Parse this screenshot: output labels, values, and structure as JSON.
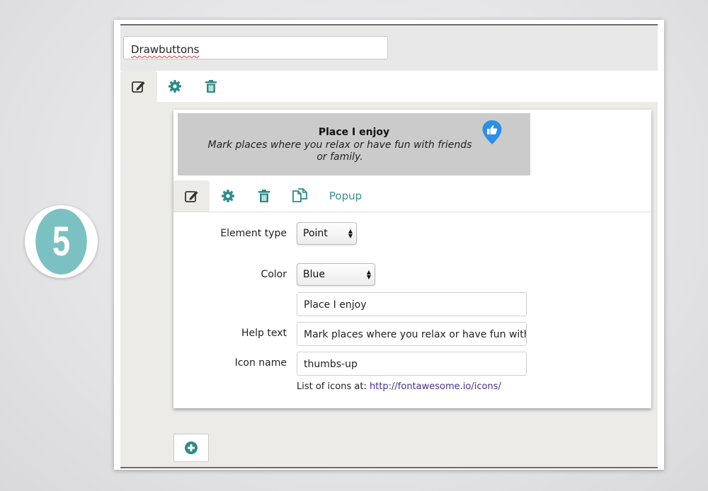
{
  "step": {
    "number": "5"
  },
  "layer": {
    "name": "Drawbuttons"
  },
  "layer_tabs": [
    "edit-icon",
    "gear-icon",
    "trash-icon"
  ],
  "preview": {
    "title": "Place I enjoy",
    "help": "Mark places where you relax or have fun with friends or family.",
    "marker_icon": "thumbs-up-icon",
    "marker_color": "#2b8fe8"
  },
  "element_tabs": {
    "popup_label": "Popup"
  },
  "form": {
    "element_type_label": "Element type",
    "element_type_value": "Point",
    "color_label": "Color",
    "color_value": "Blue",
    "title_value": "Place I enjoy",
    "help_label": "Help text",
    "help_value": "Mark places where you relax or have fun with",
    "icon_label": "Icon name",
    "icon_value": "thumbs-up",
    "icons_list_prefix": "List of icons at:",
    "icons_list_link": "http://fontawesome.io/icons/"
  },
  "colors": {
    "accent": "#2f8a86",
    "badge": "#7cc1c1"
  }
}
